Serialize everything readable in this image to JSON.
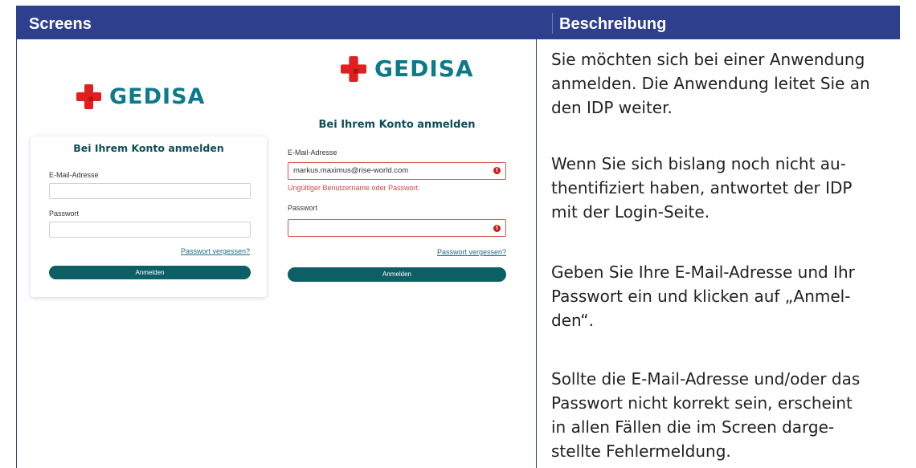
{
  "header": {
    "col1": "Screens",
    "col2": "Beschreibung"
  },
  "brand": {
    "name": "GEDISA",
    "accent": "#e02020",
    "text_color": "#0d7a8a"
  },
  "screen1": {
    "title": "Bei Ihrem Konto anmelden",
    "email_label": "E-Mail-Adresse",
    "email_value": "",
    "password_label": "Passwort",
    "forgot_link": "Passwort vergessen?",
    "login_button": "Anmelden"
  },
  "screen2": {
    "title": "Bei Ihrem Konto anmelden",
    "email_label": "E-Mail-Adresse",
    "email_value": "markus.maximus@rise-world.com",
    "error_message": "Ungültiger Benutzername oder Passwort.",
    "error_icon": "!",
    "password_label": "Passwort",
    "forgot_link": "Passwort vergessen?",
    "login_button": "Anmelden"
  },
  "description": {
    "p1": "Sie möchten sich bei einer Anwendung\nanmelden. Die Anwendung leitet Sie an\nden IDP weiter.",
    "p2": "Wenn Sie sich bislang noch nicht au-\nthentifiziert haben, antwortet der IDP\nmit der Login-Seite.",
    "p3": "Geben Sie Ihre E-Mail-Adresse und Ihr\nPasswort ein und klicken auf „Anmel-\nden“.",
    "p4": "Sollte die E-Mail-Adresse und/oder das\nPasswort nicht korrekt sein, erscheint\nin allen Fällen die im Screen darge-\nstellte Fehlermeldung."
  }
}
